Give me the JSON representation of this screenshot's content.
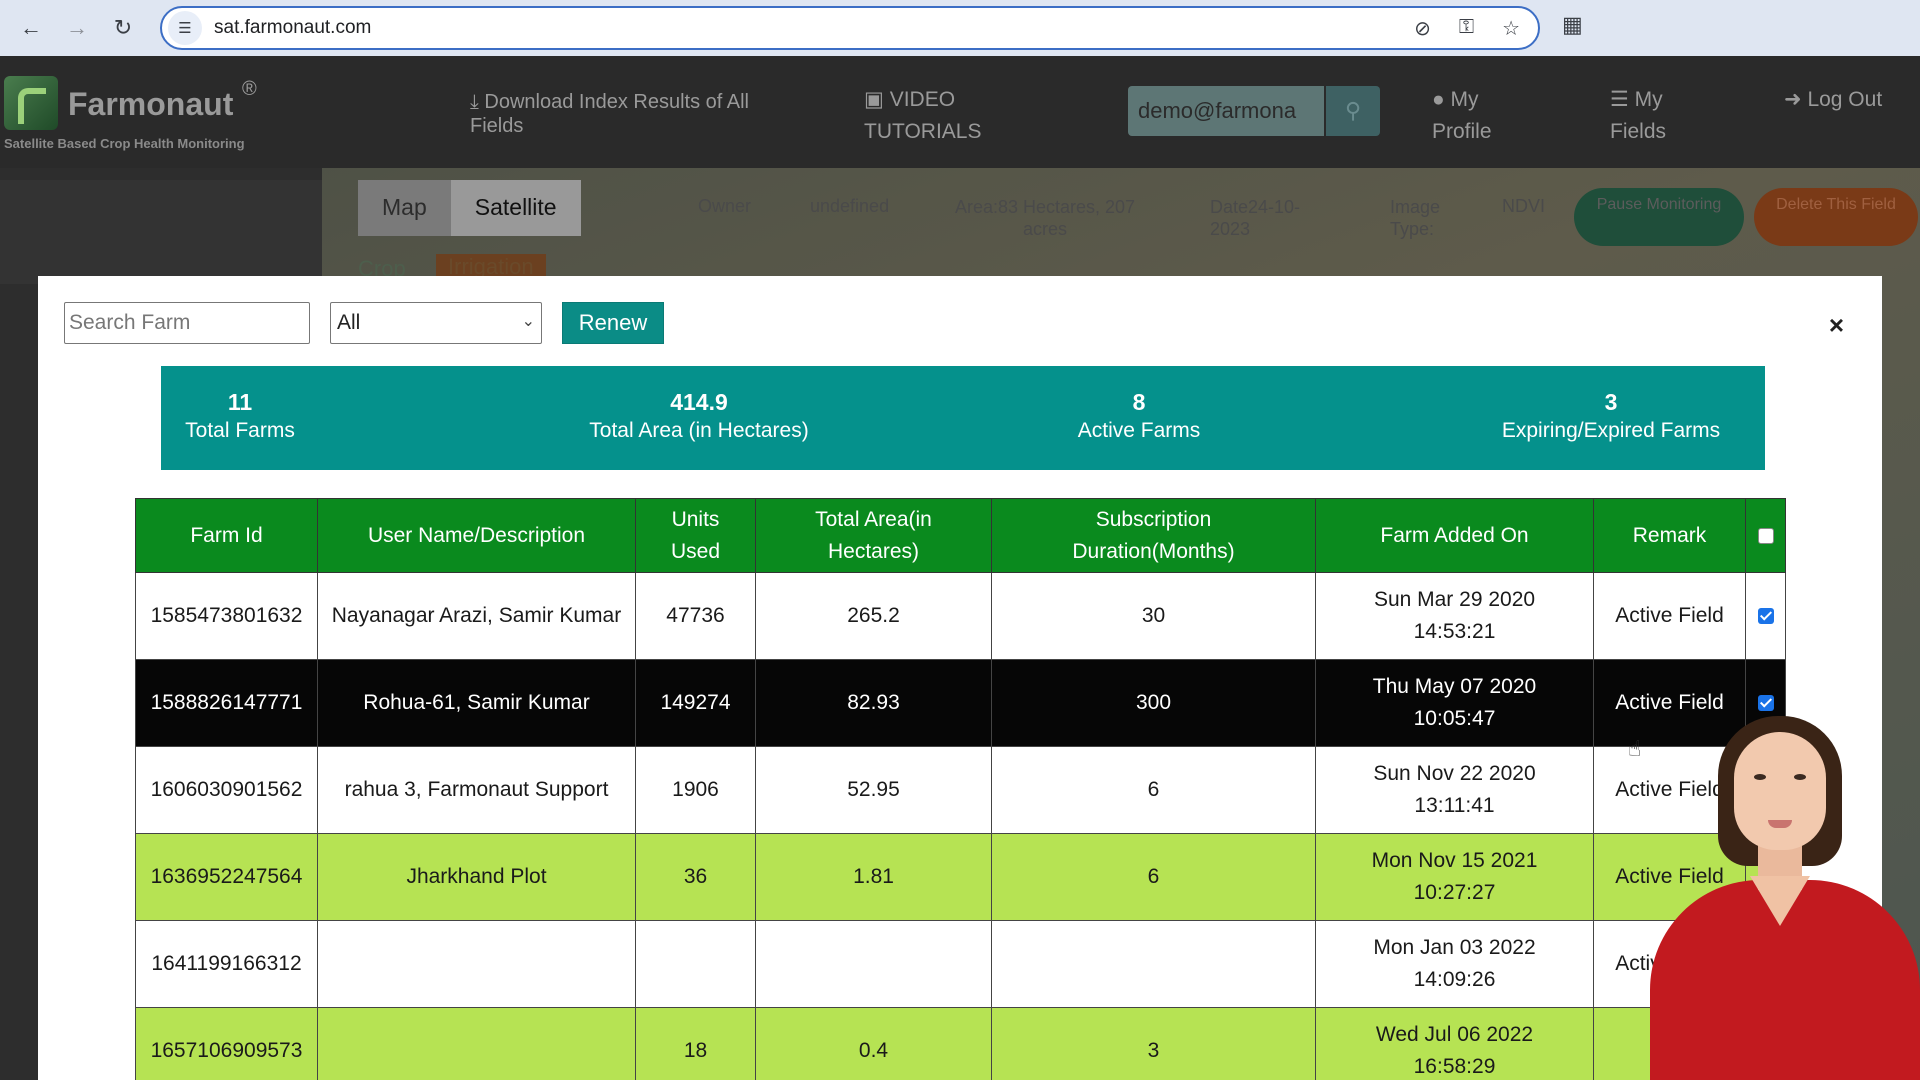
{
  "browser": {
    "url": "sat.farmonaut.com"
  },
  "header": {
    "logo_text": "Farmonaut",
    "logo_reg": "®",
    "tagline": "Satellite Based Crop Health Monitoring",
    "download_link": "Download Index Results of All Fields",
    "video_link": "VIDEO TUTORIALS",
    "user_email": "demo@farmona",
    "profile_link": "My Profile",
    "fields_link": "My Fields",
    "logout_link": "Log Out"
  },
  "background": {
    "tab_map": "Map",
    "tab_satellite": "Satellite",
    "owner_label": "Owner",
    "owner_value": "undefined",
    "area_text": "Area:83 Hectares, 207 acres",
    "date_text": "Date24-10-2023",
    "image_type_label": "Image Type:",
    "index_name": "NDVI",
    "pause_btn": "Pause Monitoring",
    "delete_btn": "Delete This Field",
    "crop_tab": "Crop",
    "irrigation_tab": "Irrigation"
  },
  "modal": {
    "search_placeholder": "Search Farm",
    "filter_value": "All",
    "renew_label": "Renew",
    "close_label": "×"
  },
  "stats": [
    {
      "value": "11",
      "label": "Total Farms"
    },
    {
      "value": "414.9",
      "label": "Total Area (in Hectares)"
    },
    {
      "value": "8",
      "label": "Active Farms"
    },
    {
      "value": "3",
      "label": "Expiring/Expired Farms"
    }
  ],
  "table": {
    "headers": [
      "Farm Id",
      "User Name/Description",
      "Units Used",
      "Total Area(in Hectares)",
      "Subscription Duration(Months)",
      "Farm Added On",
      "Remark"
    ],
    "rows": [
      {
        "style": "white",
        "farm_id": "1585473801632",
        "name": "Nayanagar Arazi, Samir Kumar",
        "units": "47736",
        "area": "265.2",
        "duration": "30",
        "added": "Sun Mar 29 2020 14:53:21",
        "remark": "Active Field",
        "checked": true
      },
      {
        "style": "black",
        "farm_id": "1588826147771",
        "name": "Rohua-61, Samir Kumar",
        "units": "149274",
        "area": "82.93",
        "duration": "300",
        "added": "Thu May 07 2020 10:05:47",
        "remark": "Active Field",
        "checked": true
      },
      {
        "style": "white",
        "farm_id": "1606030901562",
        "name": "rahua 3, Farmonaut Support",
        "units": "1906",
        "area": "52.95",
        "duration": "6",
        "added": "Sun Nov 22 2020 13:11:41",
        "remark": "Active Field",
        "checked": false
      },
      {
        "style": "green",
        "farm_id": "1636952247564",
        "name": "Jharkhand Plot",
        "units": "36",
        "area": "1.81",
        "duration": "6",
        "added": "Mon Nov 15 2021 10:27:27",
        "remark": "Active Field",
        "checked": false
      },
      {
        "style": "white",
        "farm_id": "1641199166312",
        "name": "",
        "units": "",
        "area": "",
        "duration": "",
        "added": "Mon Jan 03 2022 14:09:26",
        "remark": "Active Field",
        "checked": false
      },
      {
        "style": "green",
        "farm_id": "1657106909573",
        "name": "",
        "units": "18",
        "area": "0.4",
        "duration": "3",
        "added": "Wed Jul 06 2022 16:58:29",
        "remark": "",
        "checked": false
      }
    ]
  },
  "colors": {
    "accent_teal": "#05918c",
    "header_green": "#0a8a1e",
    "row_green": "#b6e353",
    "checkbox_blue": "#1a73e8"
  }
}
